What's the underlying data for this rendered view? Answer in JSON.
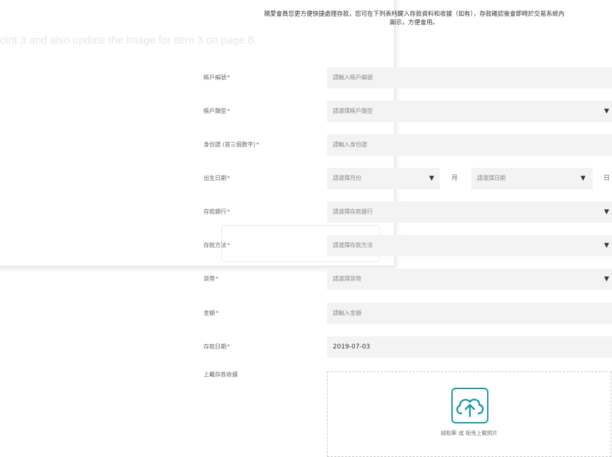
{
  "notice": {
    "line1": "親愛會員您更方便快捷處理存款，您可在下列表格鍵入存款資料和收據（如有），存款確認後會即時於交易系統內",
    "line2": "顯示，方便會用。"
  },
  "background_text": "oint 3 and also update the image for item 3 on page 8.",
  "form": {
    "account_number": {
      "label": "帳戶編號",
      "required_mark": "*",
      "placeholder": "請輸入帳戶編號"
    },
    "account_type": {
      "label": "帳戶類型",
      "required_mark": "*",
      "placeholder": "請選擇帳戶類型"
    },
    "id_number": {
      "label": "身份證 (首三個數字)",
      "required_mark": "*",
      "placeholder": "請輸入身份證"
    },
    "birth_date": {
      "label": "出生日期",
      "required_mark": "*",
      "month_placeholder": "請選擇月份",
      "month_unit": "月",
      "day_placeholder": "請選擇日期",
      "day_unit": "日"
    },
    "deposit_bank": {
      "label": "存款銀行",
      "required_mark": "*",
      "placeholder": "請選擇存款銀行"
    },
    "deposit_method": {
      "label": "存款方法",
      "required_mark": "*",
      "placeholder": "請選擇存款方法"
    },
    "currency": {
      "label": "貨幣",
      "required_mark": "*",
      "placeholder": "請選擇貨幣"
    },
    "amount": {
      "label": "金額",
      "required_mark": "*",
      "placeholder": "請輸入金額"
    },
    "deposit_date": {
      "label": "存款日期",
      "required_mark": "*",
      "value": "2019-07-03"
    },
    "receipt": {
      "label": "上載存款收據",
      "upload_caption": "請點擊 或 拖曳上載照片"
    }
  },
  "dropdown_caret": "▼",
  "colors": {
    "accent": "#1a9aa3",
    "required": "#e05050",
    "field_bg": "#f3f3f3"
  },
  "icons": {
    "upload": "cloud-upload-icon",
    "caret": "chevron-down-icon"
  }
}
